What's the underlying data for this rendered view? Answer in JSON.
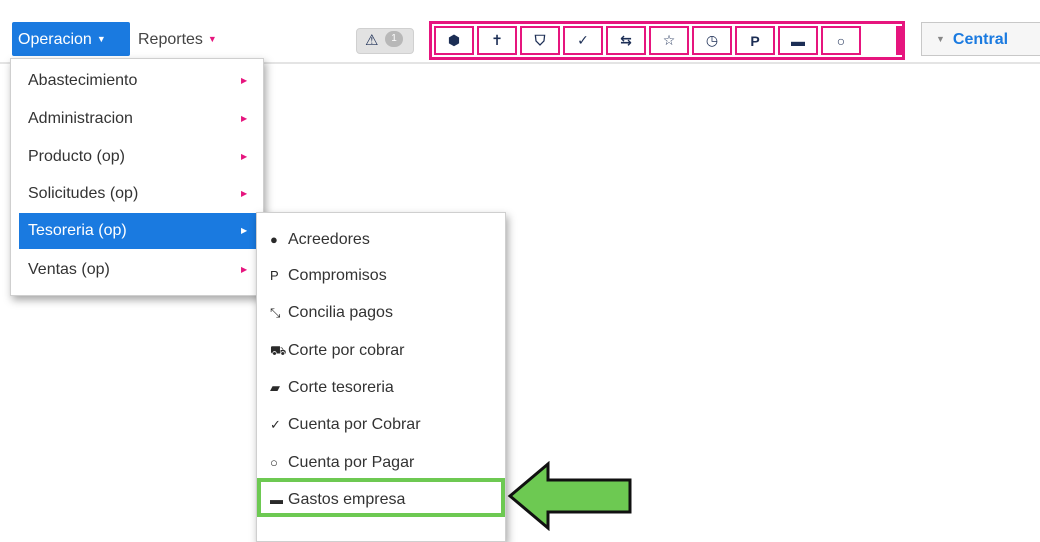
{
  "topbar": {
    "menu_operacion": "Operacion",
    "menu_reportes": "Reportes",
    "alert_badge": "1",
    "branch_label": "Central",
    "toolbar_icons": [
      {
        "name": "cube-icon",
        "glyph": "⬢"
      },
      {
        "name": "pin-icon",
        "glyph": "✝"
      },
      {
        "name": "shield-icon",
        "glyph": "⛉"
      },
      {
        "name": "check-circle-icon",
        "glyph": "✓"
      },
      {
        "name": "retweet-icon",
        "glyph": "⇆"
      },
      {
        "name": "star-icon",
        "glyph": "☆"
      },
      {
        "name": "clock-icon",
        "glyph": "◷"
      },
      {
        "name": "paypal-icon",
        "glyph": "P"
      },
      {
        "name": "id-card-icon",
        "glyph": "▬"
      },
      {
        "name": "circle-icon",
        "glyph": "○"
      }
    ]
  },
  "operacion_menu": {
    "items": [
      {
        "label": "Abastecimiento"
      },
      {
        "label": "Administracion"
      },
      {
        "label": "Producto (op)"
      },
      {
        "label": "Solicitudes (op)"
      },
      {
        "label": "Tesoreria (op)"
      },
      {
        "label": "Ventas (op)"
      }
    ],
    "active": "Tesoreria (op)"
  },
  "tesoreria_submenu": {
    "items": [
      {
        "label": "Acreedores",
        "icon": "user-circle-icon",
        "glyph": "●"
      },
      {
        "label": "Compromisos",
        "icon": "paypal-icon",
        "glyph": "P"
      },
      {
        "label": "Concilia pagos",
        "icon": "compress-icon",
        "glyph": "⤡"
      },
      {
        "label": "Corte por cobrar",
        "icon": "cart-icon",
        "glyph": "⛟"
      },
      {
        "label": "Corte tesoreria",
        "icon": "book-icon",
        "glyph": "▰"
      },
      {
        "label": "Cuenta por Cobrar",
        "icon": "check-circle-icon",
        "glyph": "✓"
      },
      {
        "label": "Cuenta por Pagar",
        "icon": "circle-icon",
        "glyph": "○"
      },
      {
        "label": "Gastos empresa",
        "icon": "id-card-icon",
        "glyph": "▬"
      }
    ],
    "highlighted": "Gastos empresa"
  },
  "colors": {
    "primary": "#1a7ae0",
    "accent": "#e6157e",
    "highlight": "#6dc952"
  }
}
